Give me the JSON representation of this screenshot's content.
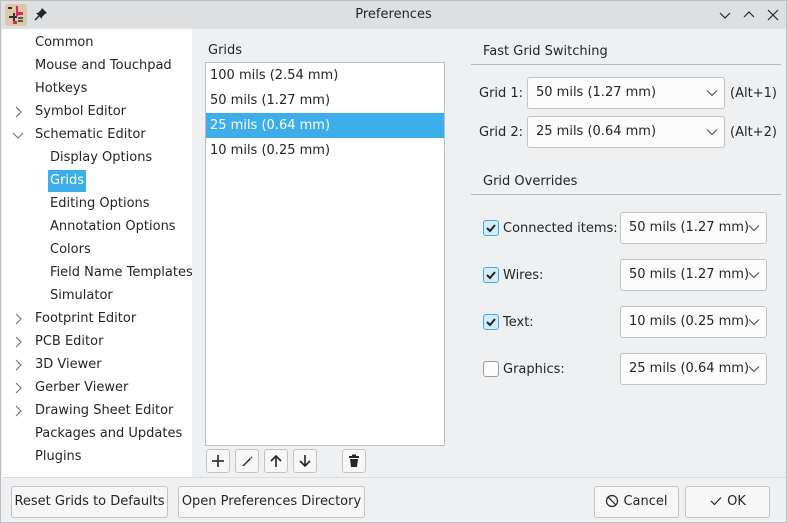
{
  "window": {
    "title": "Preferences"
  },
  "sidebar": {
    "items": [
      {
        "label": "Common",
        "level": 0,
        "expander": "none"
      },
      {
        "label": "Mouse and Touchpad",
        "level": 0,
        "expander": "none"
      },
      {
        "label": "Hotkeys",
        "level": 0,
        "expander": "none"
      },
      {
        "label": "Symbol Editor",
        "level": 0,
        "expander": "collapsed"
      },
      {
        "label": "Schematic Editor",
        "level": 0,
        "expander": "expanded"
      },
      {
        "label": "Display Options",
        "level": 1,
        "expander": "none"
      },
      {
        "label": "Grids",
        "level": 1,
        "expander": "none",
        "selected": true
      },
      {
        "label": "Editing Options",
        "level": 1,
        "expander": "none"
      },
      {
        "label": "Annotation Options",
        "level": 1,
        "expander": "none"
      },
      {
        "label": "Colors",
        "level": 1,
        "expander": "none"
      },
      {
        "label": "Field Name Templates",
        "level": 1,
        "expander": "none"
      },
      {
        "label": "Simulator",
        "level": 1,
        "expander": "none"
      },
      {
        "label": "Footprint Editor",
        "level": 0,
        "expander": "collapsed"
      },
      {
        "label": "PCB Editor",
        "level": 0,
        "expander": "collapsed"
      },
      {
        "label": "3D Viewer",
        "level": 0,
        "expander": "collapsed"
      },
      {
        "label": "Gerber Viewer",
        "level": 0,
        "expander": "collapsed"
      },
      {
        "label": "Drawing Sheet Editor",
        "level": 0,
        "expander": "collapsed"
      },
      {
        "label": "Packages and Updates",
        "level": 0,
        "expander": "none"
      },
      {
        "label": "Plugins",
        "level": 0,
        "expander": "none"
      }
    ]
  },
  "grids": {
    "label": "Grids",
    "items": [
      {
        "label": "100 mils (2.54 mm)"
      },
      {
        "label": "50 mils (1.27 mm)"
      },
      {
        "label": "25 mils (0.64 mm)",
        "selected": true
      },
      {
        "label": "10 mils (0.25 mm)"
      }
    ],
    "toolbar": {
      "add": "plus-icon",
      "edit": "pencil-icon",
      "move_up": "arrow-up-icon",
      "move_down": "arrow-down-icon",
      "delete": "trash-icon"
    }
  },
  "fast_grid": {
    "title": "Fast Grid Switching",
    "grid1": {
      "label": "Grid 1:",
      "value": "50 mils (1.27 mm)",
      "shortcut": "(Alt+1)"
    },
    "grid2": {
      "label": "Grid 2:",
      "value": "25 mils (0.64 mm)",
      "shortcut": "(Alt+2)"
    }
  },
  "overrides": {
    "title": "Grid Overrides",
    "rows": [
      {
        "label": "Connected items:",
        "checked": true,
        "value": "50 mils (1.27 mm)"
      },
      {
        "label": "Wires:",
        "checked": true,
        "value": "50 mils (1.27 mm)"
      },
      {
        "label": "Text:",
        "checked": true,
        "value": "10 mils (0.25 mm)"
      },
      {
        "label": "Graphics:",
        "checked": false,
        "value": "25 mils (0.64 mm)"
      }
    ]
  },
  "buttons": {
    "reset": "Reset Grids to Defaults",
    "open_dir": "Open Preferences Directory",
    "cancel": "Cancel",
    "ok": "OK"
  },
  "colors": {
    "accent": "#3daee9",
    "window_bg": "#eff0f1",
    "titlebar_bg": "#dedfe0"
  }
}
